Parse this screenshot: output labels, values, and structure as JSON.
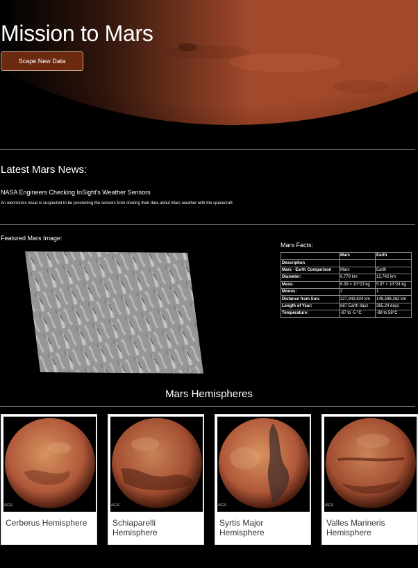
{
  "header": {
    "title": "Mission to Mars",
    "scrape_button": "Scape New Data"
  },
  "news": {
    "section_title": "Latest Mars News:",
    "headline": "NASA Engineers Checking InSight's Weather Sensors",
    "teaser": "An electronics issue is suspected to be preventing the sensors from sharing their data about Mars weather with the spacecraft."
  },
  "featured": {
    "label": "Featured Mars Image:"
  },
  "facts": {
    "label": "Mars Facts:",
    "columns": [
      "",
      "Mars",
      "Earth"
    ],
    "rows": [
      [
        "Description",
        "",
        ""
      ],
      [
        "Mars - Earth Comparison",
        "Mars",
        "Earth"
      ],
      [
        "Diameter:",
        "6,779 km",
        "12,742 km"
      ],
      [
        "Mass:",
        "6.39 × 10^23 kg",
        "5.97 × 10^24 kg"
      ],
      [
        "Moons:",
        "2",
        "1"
      ],
      [
        "Distance from Sun:",
        "227,943,824 km",
        "149,598,262 km"
      ],
      [
        "Length of Year:",
        "687 Earth days",
        "365.24 days"
      ],
      [
        "Temperature:",
        "-87 to -5 °C",
        "-88 to 58°C"
      ]
    ]
  },
  "hemispheres": {
    "title": "Mars Hemispheres",
    "items": [
      {
        "name": "Cerberus Hemisphere",
        "watermark": "USGS"
      },
      {
        "name": "Schiaparelli Hemisphere",
        "watermark": "USGS"
      },
      {
        "name": "Syrtis Major Hemisphere",
        "watermark": "USGS"
      },
      {
        "name": "Valles Marineris Hemisphere",
        "watermark": "USGS"
      }
    ]
  },
  "colors": {
    "background": "#000000",
    "button": "#6b2a10",
    "mars": "#b0583a"
  }
}
